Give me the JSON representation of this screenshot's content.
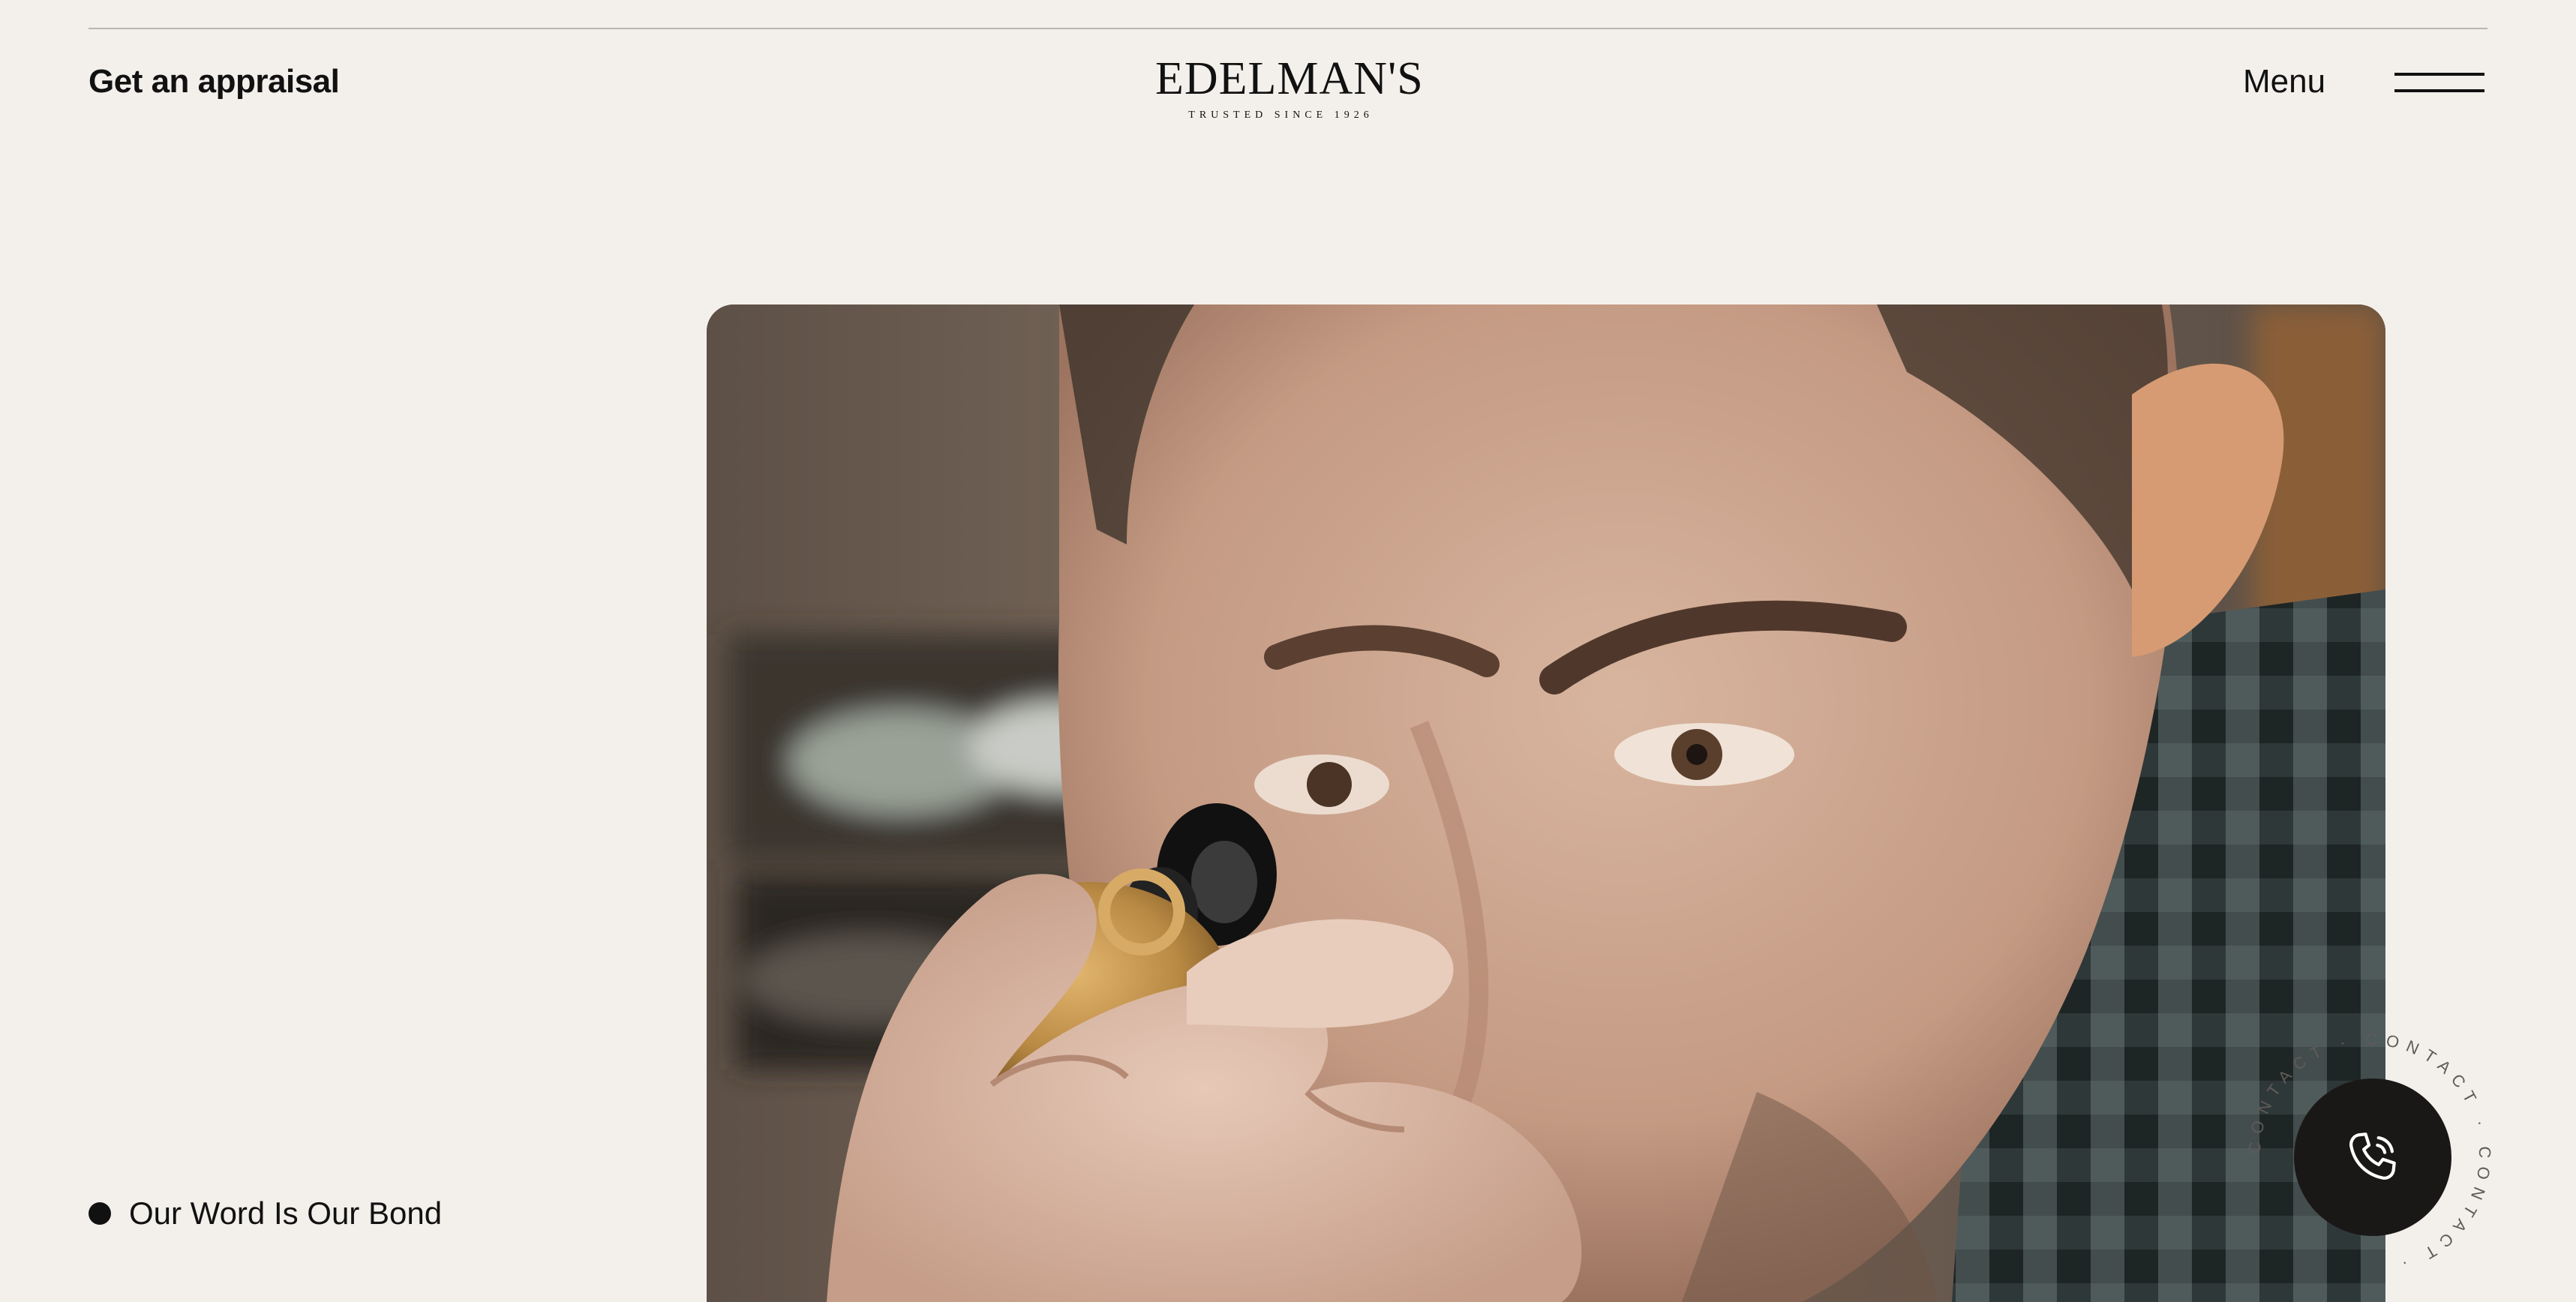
{
  "header": {
    "appraisal_label": "Get an appraisal",
    "brand_name": "EDELMAN'S",
    "brand_tagline": "TRUSTED SINCE 1926",
    "menu_label": "Menu"
  },
  "hero": {
    "tagline": "Our Word Is Our Bond"
  },
  "contact_badge": {
    "ring_text": "CONTACT · CONTACT · CONTACT ·",
    "icon": "phone-icon"
  },
  "colors": {
    "background": "#f3f0ec",
    "text": "#111111",
    "contact_button": "#1a1817"
  }
}
